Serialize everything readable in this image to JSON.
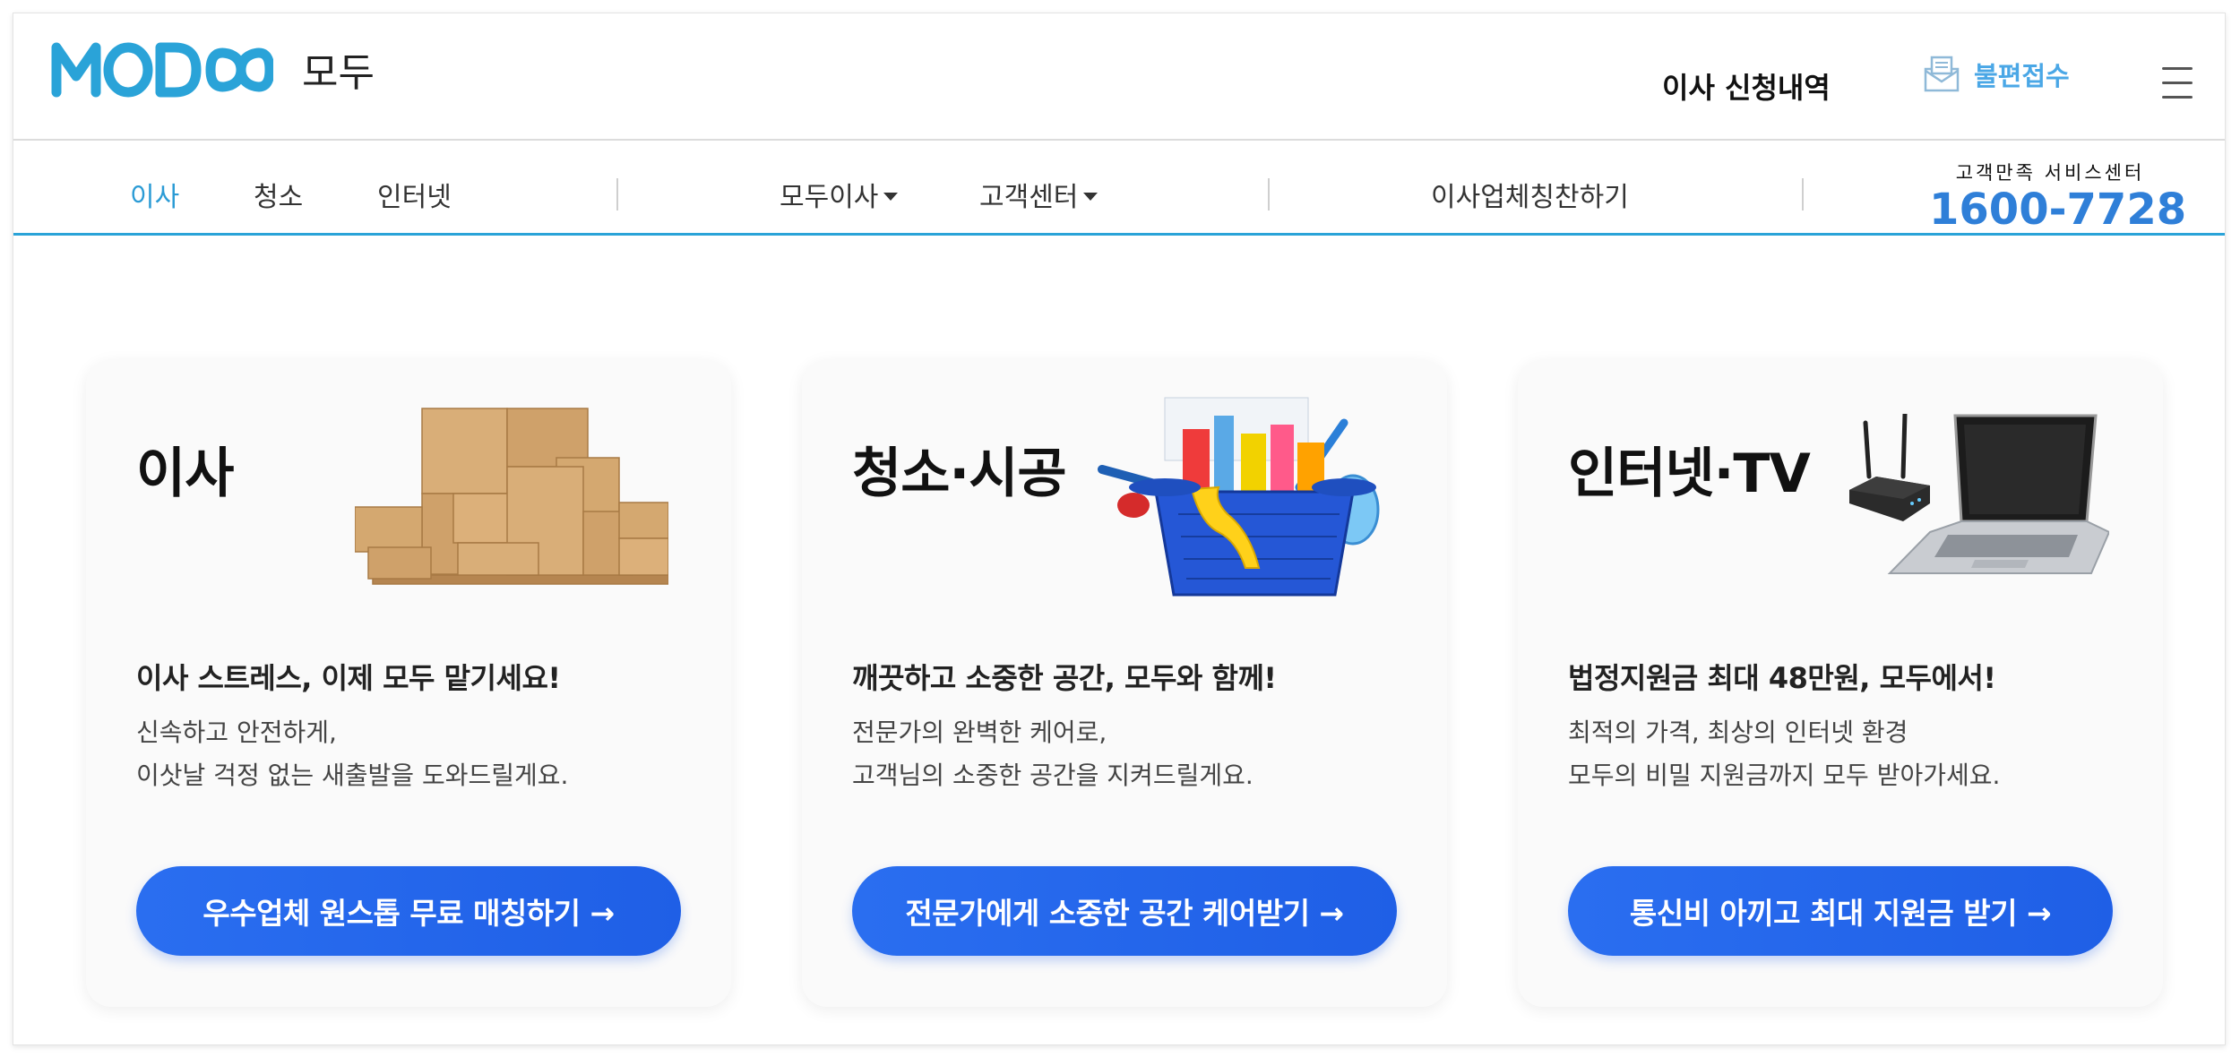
{
  "header": {
    "logo_text": "MODOO",
    "brand_name": "모두",
    "move_requests_label": "이사 신청내역",
    "complaint_label": "불편접수",
    "complaint_icon": "envelope-icon",
    "menu_icon": "hamburger-menu-icon"
  },
  "nav": {
    "items": [
      {
        "label": "이사",
        "active": true
      },
      {
        "label": "청소"
      },
      {
        "label": "인터넷"
      }
    ],
    "dropdowns": [
      {
        "label": "모두이사"
      },
      {
        "label": "고객센터"
      }
    ],
    "praise_label": "이사업체칭찬하기",
    "customer_service": {
      "label": "고객만족 서비스센터",
      "phone": "1600-7728"
    }
  },
  "cards": [
    {
      "title": "이사",
      "image": "moving-boxes-image",
      "headline": "이사 스트레스, 이제 모두 맡기세요!",
      "desc_line1": "신속하고 안전하게,",
      "desc_line2": "이삿날 걱정 없는 새출발을 도와드릴게요.",
      "cta": "우수업체 원스톱 무료 매칭하기 →"
    },
    {
      "title": "청소·시공",
      "image": "cleaning-basket-image",
      "headline": "깨끗하고 소중한 공간, 모두와 함께!",
      "desc_line1": "전문가의 완벽한 케어로,",
      "desc_line2": "고객님의 소중한 공간을 지켜드릴게요.",
      "cta": "전문가에게 소중한 공간 케어받기 →"
    },
    {
      "title": "인터넷·TV",
      "image": "router-laptop-image",
      "headline": "법정지원금 최대 48만원, 모두에서!",
      "desc_line1": "최적의 가격, 최상의 인터넷 환경",
      "desc_line2": "모두의 비밀 지원금까지 모두 받아가세요.",
      "cta": "통신비 아끼고 최대 지원금 받기 →"
    }
  ],
  "colors": {
    "brand": "#2aa3d8",
    "cta": "#2a6ef0",
    "phone": "#2f7fd8",
    "complaint": "#4aa7e6"
  }
}
